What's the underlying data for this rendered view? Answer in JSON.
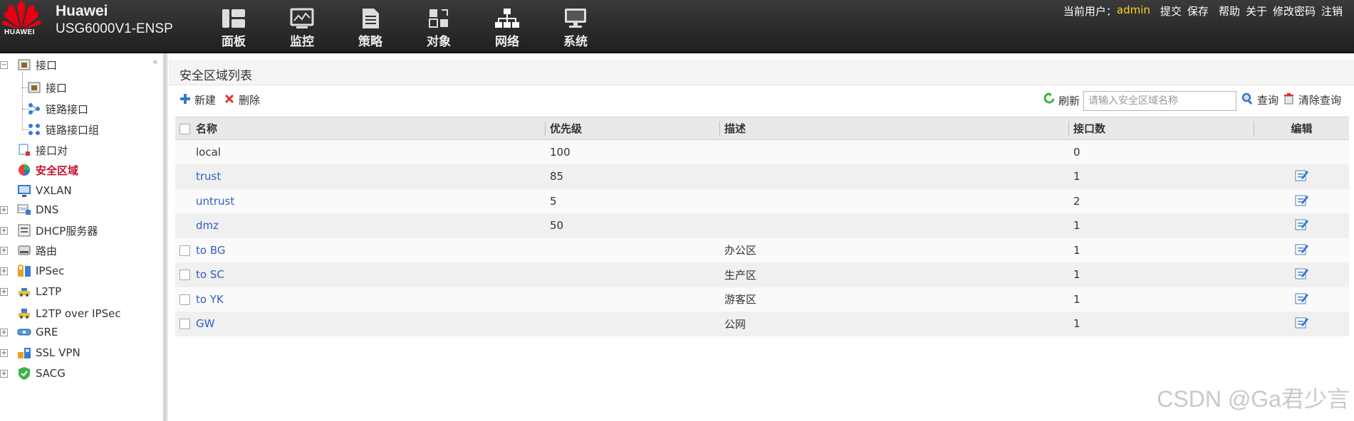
{
  "header": {
    "brand_line1": "Huawei",
    "brand_line2": "USG6000V1-ENSP",
    "logo_text": "HUAWEI",
    "nav": [
      {
        "label": "面板",
        "icon": "dashboard-icon"
      },
      {
        "label": "监控",
        "icon": "monitor-icon"
      },
      {
        "label": "策略",
        "icon": "policy-icon"
      },
      {
        "label": "对象",
        "icon": "object-icon"
      },
      {
        "label": "网络",
        "icon": "network-icon"
      },
      {
        "label": "系统",
        "icon": "system-icon"
      }
    ],
    "current_user_label": "当前用户：",
    "current_user": "admin",
    "submit": "提交",
    "save": "保存",
    "help": "帮助",
    "about": "关于",
    "change_password": "修改密码",
    "logout": "注销"
  },
  "sidebar": {
    "items": [
      {
        "label": "接口",
        "icon": "interface-icon"
      },
      {
        "label": "接口",
        "icon": "interface-icon"
      },
      {
        "label": "链路接口",
        "icon": "link-interface-icon"
      },
      {
        "label": "链路接口组",
        "icon": "link-interface-group-icon"
      },
      {
        "label": "接口对",
        "icon": "interface-pair-icon"
      },
      {
        "label": "安全区域",
        "icon": "security-zone-icon"
      },
      {
        "label": "VXLAN",
        "icon": "vxlan-icon"
      },
      {
        "label": "DNS",
        "icon": "dns-icon"
      },
      {
        "label": "DHCP服务器",
        "icon": "dhcp-icon"
      },
      {
        "label": "路由",
        "icon": "route-icon"
      },
      {
        "label": "IPSec",
        "icon": "ipsec-icon"
      },
      {
        "label": "L2TP",
        "icon": "l2tp-icon"
      },
      {
        "label": "L2TP over IPSec",
        "icon": "l2tp-ipsec-icon"
      },
      {
        "label": "GRE",
        "icon": "gre-icon"
      },
      {
        "label": "SSL VPN",
        "icon": "sslvpn-icon"
      },
      {
        "label": "SACG",
        "icon": "sacg-icon"
      }
    ]
  },
  "panel": {
    "title": "安全区域列表",
    "new": "新建",
    "delete": "删除",
    "refresh": "刷新",
    "search_placeholder": "请输入安全区域名称",
    "query": "查询",
    "clear_query": "清除查询"
  },
  "table": {
    "columns": [
      "名称",
      "优先级",
      "描述",
      "接口数",
      "编辑"
    ],
    "rows": [
      {
        "name": "local",
        "priority": "100",
        "desc": "",
        "ifcount": "0",
        "checkbox": false,
        "link": false,
        "editable": false
      },
      {
        "name": "trust",
        "priority": "85",
        "desc": "",
        "ifcount": "1",
        "checkbox": false,
        "link": true,
        "editable": true
      },
      {
        "name": "untrust",
        "priority": "5",
        "desc": "",
        "ifcount": "2",
        "checkbox": false,
        "link": true,
        "editable": true
      },
      {
        "name": "dmz",
        "priority": "50",
        "desc": "",
        "ifcount": "1",
        "checkbox": false,
        "link": true,
        "editable": true
      },
      {
        "name": "to BG",
        "priority": "",
        "desc": "办公区",
        "ifcount": "1",
        "checkbox": true,
        "link": true,
        "editable": true
      },
      {
        "name": "to SC",
        "priority": "",
        "desc": "生产区",
        "ifcount": "1",
        "checkbox": true,
        "link": true,
        "editable": true
      },
      {
        "name": "to YK",
        "priority": "",
        "desc": "游客区",
        "ifcount": "1",
        "checkbox": true,
        "link": true,
        "editable": true
      },
      {
        "name": "GW",
        "priority": "",
        "desc": "公网",
        "ifcount": "1",
        "checkbox": true,
        "link": true,
        "editable": true
      }
    ]
  },
  "watermark": "CSDN @Ga君少言",
  "colors": {
    "accent_red": "#c8102e",
    "link_blue": "#2e5fc6",
    "user_yellow": "#ffd21a"
  }
}
